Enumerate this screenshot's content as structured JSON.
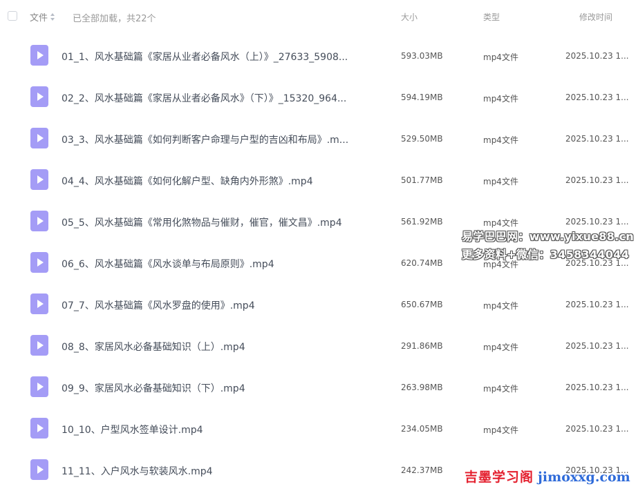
{
  "header": {
    "name_label": "文件",
    "loaded_text": "已全部加载，共22个",
    "size_label": "大小",
    "type_label": "类型",
    "time_label": "修改时间"
  },
  "files": [
    {
      "name": "01_1、风水基础篇《家居从业者必备风水（上）》_27633_5908...",
      "size": "593.03MB",
      "type": "mp4文件",
      "time": "2025.10.23 1..."
    },
    {
      "name": "02_2、风水基础篇《家居从业者必备风水》（下）》_15320_964...",
      "size": "594.19MB",
      "type": "mp4文件",
      "time": "2025.10.23 1..."
    },
    {
      "name": "03_3、风水基础篇《如何判断客户命理与户型的吉凶和布局》.m...",
      "size": "529.50MB",
      "type": "mp4文件",
      "time": "2025.10.23 1..."
    },
    {
      "name": "04_4、风水基础篇《如何化解户型、缺角内外形煞》.mp4",
      "size": "501.77MB",
      "type": "mp4文件",
      "time": "2025.10.23 1..."
    },
    {
      "name": "05_5、风水基础篇《常用化煞物品与催财，催官，催文昌》.mp4",
      "size": "561.92MB",
      "type": "mp4文件",
      "time": "2025.10.23 1..."
    },
    {
      "name": "06_6、风水基础篇《风水谈单与布局原则》.mp4",
      "size": "620.74MB",
      "type": "mp4文件",
      "time": "2025.10.23 1..."
    },
    {
      "name": "07_7、风水基础篇《风水罗盘的使用》.mp4",
      "size": "650.67MB",
      "type": "mp4文件",
      "time": "2025.10.23 1..."
    },
    {
      "name": "08_8、家居风水必备基础知识（上）.mp4",
      "size": "291.86MB",
      "type": "mp4文件",
      "time": "2025.10.23 1..."
    },
    {
      "name": "09_9、家居风水必备基础知识（下）.mp4",
      "size": "263.98MB",
      "type": "mp4文件",
      "time": "2025.10.23 1..."
    },
    {
      "name": "10_10、户型风水签单设计.mp4",
      "size": "234.05MB",
      "type": "mp4文件",
      "time": "2025.10.23 1..."
    },
    {
      "name": "11_11、入户风水与软装风水.mp4",
      "size": "242.37MB",
      "type": "",
      "time": "2025.10.23 1..."
    }
  ],
  "icons": {
    "video_file": "video-file-icon",
    "sort": "sort-icon"
  },
  "colors": {
    "icon_purple": "#a49cf6",
    "watermark_red": "#e4202e",
    "watermark_blue": "#2f6bd9"
  },
  "watermark": {
    "line1": "易学巴巴网：www.yixue88.cn",
    "line2": "更多资料+微信：3458344044",
    "brand_cn": "吉墨学习阁",
    "brand_url": "jimoxxg.com"
  }
}
